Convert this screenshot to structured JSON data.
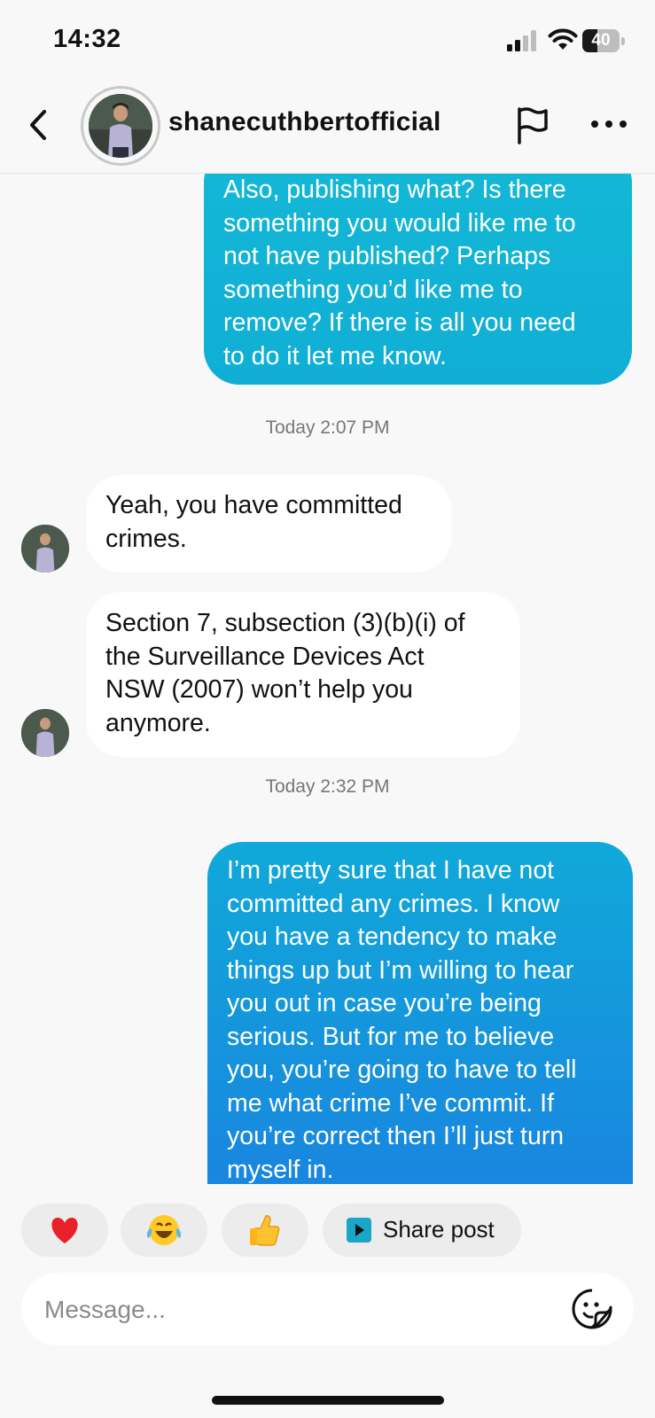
{
  "status_bar": {
    "time": "14:32",
    "battery_level": "40",
    "icons": [
      "signal-icon",
      "wifi-icon",
      "battery-icon"
    ]
  },
  "header": {
    "username": "shanecuthbertofficial",
    "icons": [
      "chevron-left-icon",
      "flag-icon",
      "more-horizontal-icon"
    ]
  },
  "messages": [
    {
      "direction": "out",
      "text": "Also, publishing what? Is there\nsomething you would like me to\nnot have published? Perhaps\nsomething you’d like me to\nremove? If there is all you need\nto do it let me know."
    },
    {
      "type": "timestamp",
      "text": "Today 2:07 PM"
    },
    {
      "direction": "in",
      "text": "Yeah, you have committed\ncrimes."
    },
    {
      "direction": "in",
      "text": "Section 7, subsection (3)(b)(i) of\nthe Surveillance Devices Act\nNSW (2007) won’t help you\nanymore."
    },
    {
      "type": "timestamp",
      "text": "Today 2:32 PM"
    },
    {
      "direction": "out",
      "text": "I’m pretty sure that I have not\ncommitted any crimes. I know\nyou have a tendency to make\nthings up but I’m willing to hear\nyou out in case you’re being\nserious. But for me to believe\nyou, you’re going to have to tell\nme what crime I’ve commit. If\nyou’re correct then I’ll just turn\nmyself in."
    }
  ],
  "quick_reactions": [
    {
      "icon": "red-heart-emoji"
    },
    {
      "icon": "face-with-tears-of-joy-emoji"
    },
    {
      "icon": "thumbs-up-emoji"
    },
    {
      "icon": "share-post-icon",
      "label": "Share post"
    }
  ],
  "composer": {
    "placeholder": "Message...",
    "icon": "sticker-icon"
  },
  "colors": {
    "outgoing_bubble_top": "#10b2d3",
    "outgoing_bubble_bottom": "#1a7fe0",
    "incoming_bubble": "#ffffff",
    "background": "#f8f8f8",
    "timestamp_text": "#777777"
  }
}
